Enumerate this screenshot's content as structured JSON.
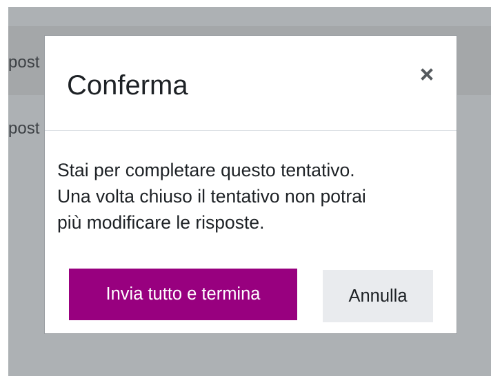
{
  "background": {
    "row_1_fragment": "post",
    "row_2_fragment": "post"
  },
  "dialog": {
    "title": "Conferma",
    "close_icon": "close-icon",
    "message_lines": [
      "Stai per completare questo tentativo.",
      "Una volta chiuso il tentativo non potrai",
      "più modificare le risposte."
    ],
    "primary_button_label": "Invia tutto e termina",
    "secondary_button_label": "Annulla"
  },
  "colors": {
    "primary_button": "#98007f",
    "overlay": "#adb1b4",
    "secondary_button": "#e9ebee"
  }
}
